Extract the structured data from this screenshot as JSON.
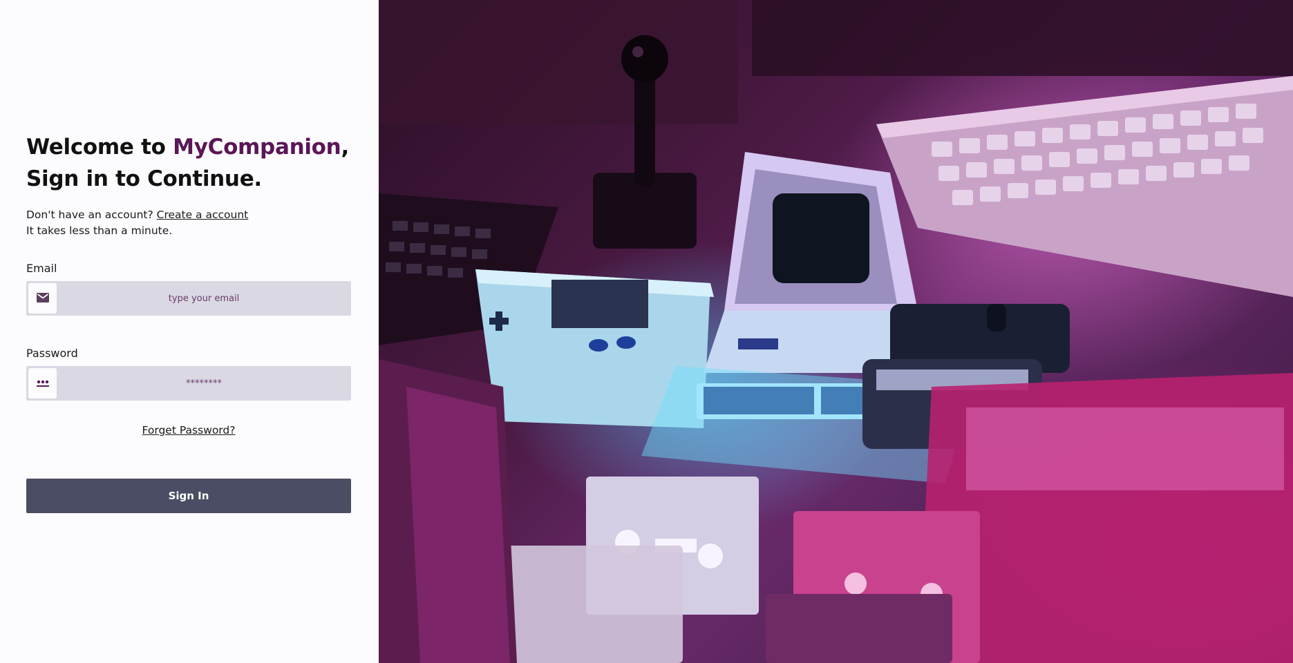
{
  "heading": {
    "prefix": "Welcome to ",
    "brand": "MyCompanion",
    "suffix": ",",
    "line2": "Sign in to Continue."
  },
  "signup": {
    "prompt": "Don't have an account? ",
    "link": "Create a account",
    "note": "It takes less than a minute."
  },
  "email": {
    "label": "Email",
    "placeholder": "type your email",
    "icon": "mail-icon"
  },
  "password": {
    "label": "Password",
    "placeholder": "********",
    "icon": "dots-icon"
  },
  "forgot_label": "Forget Password?",
  "signin_label": "Sign In",
  "colors": {
    "brand": "#5a1656",
    "button": "#4a4d63",
    "field_bg": "#d9d8e3"
  }
}
